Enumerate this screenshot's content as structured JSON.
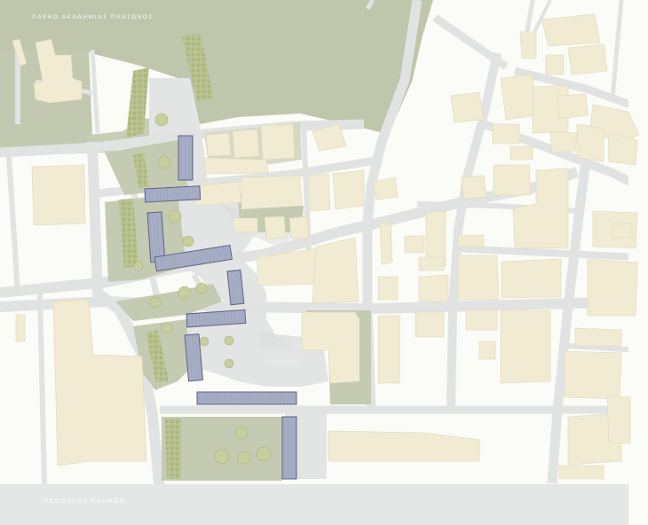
{
  "map": {
    "labels": {
      "park": "ΠΑΡΚΟ ΑΚΑΔΗΜΙΑΣ ΠΛΑΤΩΝΟΣ",
      "avenue": "ΛΕΩΦΟΡΟΣ ΑΘΗΝΩΝ"
    },
    "colors": {
      "background": "#fbfbf7",
      "park_green": "#bfc6ac",
      "plot_green": "#c4cbb2",
      "street": "#e1e3e3",
      "building": "#f0ebd2",
      "building_edge": "#e3dcbd",
      "proposed_block": "#a7adc4",
      "proposed_block_edge": "#5e6385",
      "plaza": "#e3e5e5",
      "avenue": "#e5e7e7"
    }
  }
}
